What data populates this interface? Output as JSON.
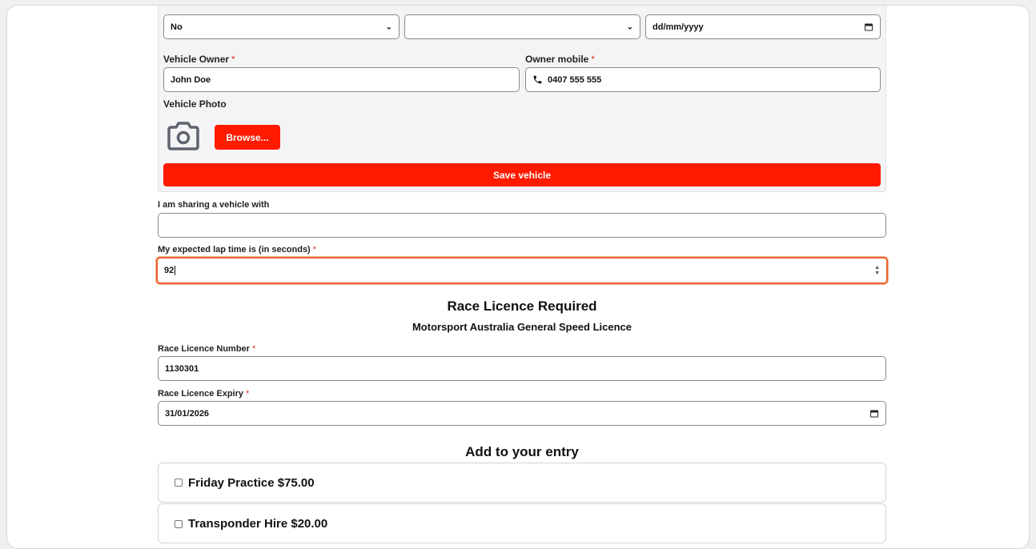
{
  "vehicle_panel": {
    "select1_value": "No",
    "select2_value": "",
    "date_placeholder": "dd/mm/yyyy",
    "owner_label": "Vehicle Owner",
    "owner_value": "John Doe",
    "mobile_label": "Owner mobile",
    "mobile_value": "0407 555 555",
    "photo_label": "Vehicle Photo",
    "browse_label": "Browse...",
    "save_label": "Save vehicle",
    "required_mark": "*"
  },
  "sharing": {
    "label": "I am sharing a vehicle with",
    "value": ""
  },
  "lap_time": {
    "label": "My expected lap time is (in seconds)",
    "value": "92"
  },
  "licence": {
    "heading": "Race Licence Required",
    "subheading": "Motorsport Australia General Speed Licence",
    "number_label": "Race Licence Number",
    "number_value": "1130301",
    "expiry_label": "Race Licence Expiry",
    "expiry_value": "31/01/2026"
  },
  "addons": {
    "heading": "Add to your entry",
    "items": [
      {
        "label": "Friday Practice $75.00"
      },
      {
        "label": "Transponder Hire $20.00"
      }
    ]
  },
  "colors": {
    "accent": "#ff1a00",
    "focus": "#e8622a",
    "required": "#e5331f"
  },
  "icons": {
    "camera": "camera-icon",
    "phone": "phone-icon",
    "calendar": "calendar-icon",
    "chevron": "chevron-down-icon"
  }
}
